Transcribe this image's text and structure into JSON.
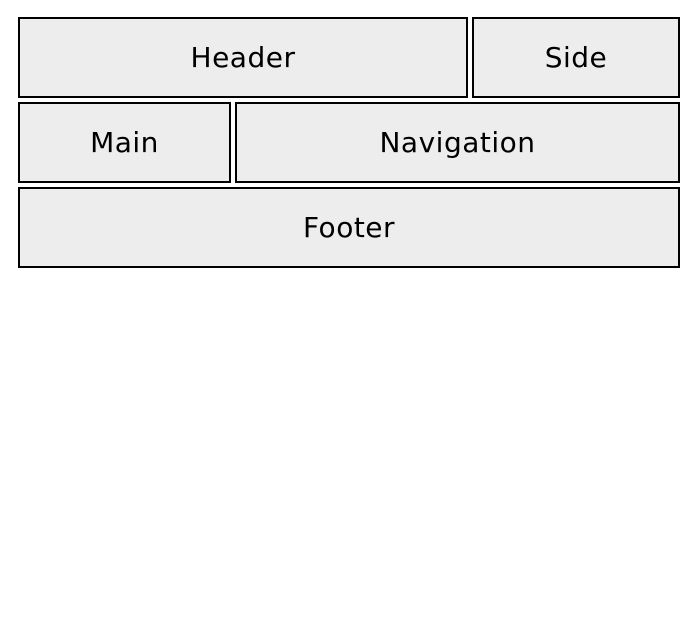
{
  "layout": {
    "header": {
      "label": "Header"
    },
    "side": {
      "label": "Side"
    },
    "main": {
      "label": "Main"
    },
    "navigation": {
      "label": "Navigation"
    },
    "footer": {
      "label": "Footer"
    }
  },
  "colors": {
    "box_fill": "#ededed",
    "box_border": "#000000",
    "text": "#000000",
    "background": "#ffffff"
  }
}
